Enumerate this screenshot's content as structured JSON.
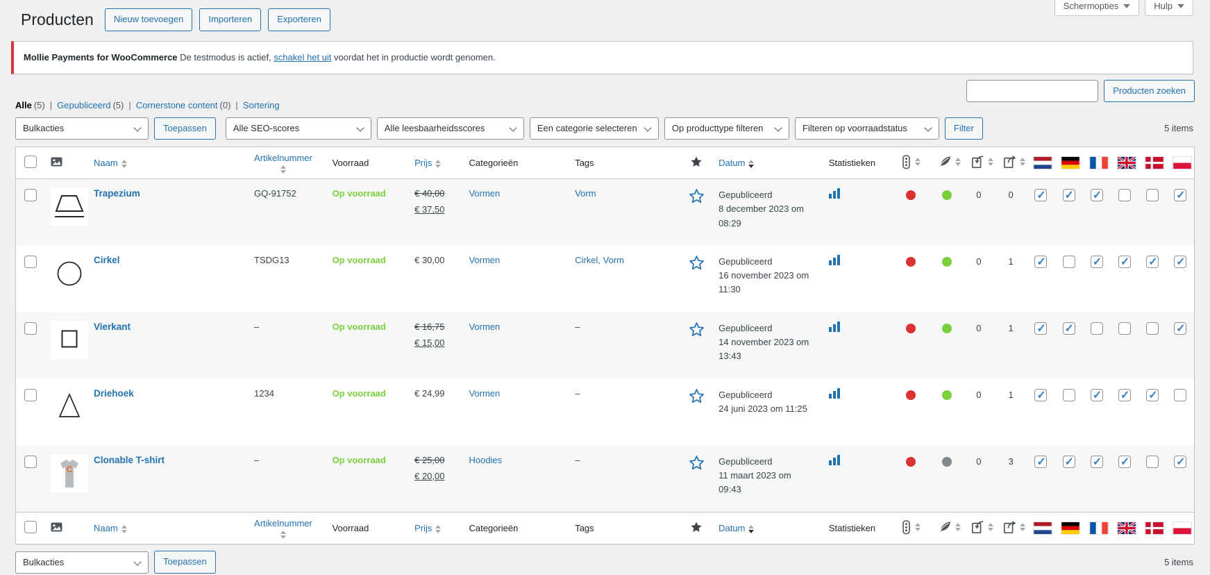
{
  "page_title": "Producten",
  "title_buttons": [
    {
      "label": "Nieuw toevoegen"
    },
    {
      "label": "Importeren"
    },
    {
      "label": "Exporteren"
    }
  ],
  "screen_meta": {
    "screen_options_label": "Schermopties",
    "help_label": "Hulp"
  },
  "notice": {
    "plugin_name": "Mollie Payments for WooCommerce",
    "text_before_link": "De testmodus is actief,",
    "link_label": "schakel het uit",
    "text_after_link": "voordat het in productie wordt genomen."
  },
  "views": [
    {
      "label": "Alle",
      "count": "(5)",
      "current": true
    },
    {
      "label": "Gepubliceerd",
      "count": "(5)",
      "current": false
    },
    {
      "label": "Cornerstone content",
      "count": "(0)",
      "current": false
    },
    {
      "label": "Sortering",
      "count": "",
      "current": false
    }
  ],
  "search": {
    "input_value": "",
    "button_label": "Producten zoeken"
  },
  "tablenav_top": {
    "bulk_actions_selected": "Bulkacties",
    "apply_label": "Toepassen",
    "seo_filter_selected": "Alle SEO-scores",
    "readability_filter_selected": "Alle leesbaarheidsscores",
    "category_filter_selected": "Een categorie selecteren",
    "type_filter_selected": "Op producttype filteren",
    "stock_filter_selected": "Filteren op voorraadstatus",
    "filter_button_label": "Filter",
    "items_count": "5 items"
  },
  "table": {
    "column_labels": {
      "name": "Naam",
      "sku": "Artikelnummer",
      "stock": "Voorraad",
      "price": "Prijs",
      "categories": "Categorieën",
      "tags": "Tags",
      "date": "Datum",
      "stats": "Statistieken"
    },
    "sorted_column": "date",
    "sorted_direction": "desc",
    "flag_columns": [
      "netherlands",
      "germany",
      "france",
      "united-kingdom",
      "denmark",
      "poland"
    ],
    "rows": [
      {
        "name": "Trapezium",
        "image": "trapezium",
        "sku": "GQ-91752",
        "stock_status": "Op voorraad",
        "price_regular": "€ 40,00",
        "price_sale": "€ 37,50",
        "price": "",
        "categories": "Vormen",
        "tags": "Vorm",
        "published_status": "Gepubliceerd",
        "published_date": "8 december 2023 om 08:29",
        "seo_score": "red",
        "readability_score": "green",
        "internal_links": "0",
        "outgoing_links": "0",
        "translations": [
          true,
          true,
          true,
          false,
          false,
          true
        ]
      },
      {
        "name": "Cirkel",
        "image": "cirkel",
        "sku": "TSDG13",
        "stock_status": "Op voorraad",
        "price_regular": "",
        "price_sale": "",
        "price": "€ 30,00",
        "categories": "Vormen",
        "tags": "Cirkel, Vorm",
        "published_status": "Gepubliceerd",
        "published_date": "16 november 2023 om 11:30",
        "seo_score": "red",
        "readability_score": "green",
        "internal_links": "0",
        "outgoing_links": "1",
        "translations": [
          true,
          false,
          true,
          true,
          true,
          true
        ]
      },
      {
        "name": "Vierkant",
        "image": "vierkant",
        "sku": "–",
        "stock_status": "Op voorraad",
        "price_regular": "€ 16,75",
        "price_sale": "€ 15,00",
        "price": "",
        "categories": "Vormen",
        "tags": "–",
        "published_status": "Gepubliceerd",
        "published_date": "14 november 2023 om 13:43",
        "seo_score": "red",
        "readability_score": "green",
        "internal_links": "0",
        "outgoing_links": "1",
        "translations": [
          true,
          true,
          false,
          false,
          false,
          true
        ]
      },
      {
        "name": "Driehoek",
        "image": "driehoek",
        "sku": "1234",
        "stock_status": "Op voorraad",
        "price_regular": "",
        "price_sale": "",
        "price": "€ 24,99",
        "categories": "Vormen",
        "tags": "–",
        "published_status": "Gepubliceerd",
        "published_date": "24 juni 2023 om 11:25",
        "seo_score": "red",
        "readability_score": "green",
        "internal_links": "0",
        "outgoing_links": "1",
        "translations": [
          true,
          false,
          true,
          true,
          true,
          false
        ]
      },
      {
        "name": "Clonable T-shirt",
        "image": "tshirt",
        "sku": "–",
        "stock_status": "Op voorraad",
        "price_regular": "€ 25,00",
        "price_sale": "€ 20,00",
        "price": "",
        "categories": "Hoodies",
        "tags": "–",
        "published_status": "Gepubliceerd",
        "published_date": "11 maart 2023 om 09:43",
        "seo_score": "red",
        "readability_score": "gray",
        "internal_links": "0",
        "outgoing_links": "3",
        "translations": [
          true,
          true,
          true,
          true,
          false,
          true
        ]
      }
    ]
  },
  "tablenav_bottom": {
    "bulk_actions_selected": "Bulkacties",
    "apply_label": "Toepassen",
    "items_count": "5 items"
  },
  "colors": {
    "accent_blue": "#2271b1",
    "notice_red": "#d63638",
    "in_stock_green": "#7ad03a",
    "seo_score_red": "#dc3232",
    "score_gray": "#82878c"
  }
}
